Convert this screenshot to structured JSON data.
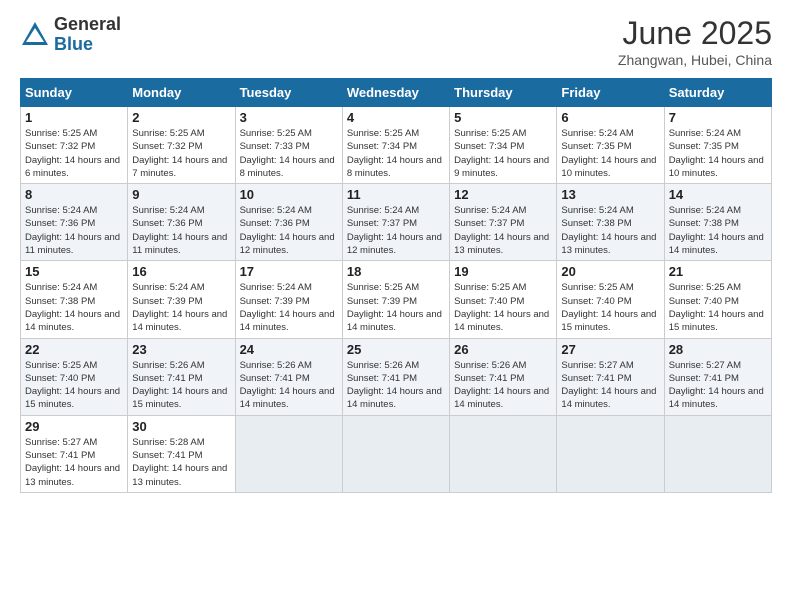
{
  "header": {
    "logo_general": "General",
    "logo_blue": "Blue",
    "month_title": "June 2025",
    "location": "Zhangwan, Hubei, China"
  },
  "days_of_week": [
    "Sunday",
    "Monday",
    "Tuesday",
    "Wednesday",
    "Thursday",
    "Friday",
    "Saturday"
  ],
  "weeks": [
    [
      {
        "day": 1,
        "sunrise": "5:25 AM",
        "sunset": "7:32 PM",
        "daylight": "14 hours and 6 minutes."
      },
      {
        "day": 2,
        "sunrise": "5:25 AM",
        "sunset": "7:32 PM",
        "daylight": "14 hours and 7 minutes."
      },
      {
        "day": 3,
        "sunrise": "5:25 AM",
        "sunset": "7:33 PM",
        "daylight": "14 hours and 8 minutes."
      },
      {
        "day": 4,
        "sunrise": "5:25 AM",
        "sunset": "7:34 PM",
        "daylight": "14 hours and 8 minutes."
      },
      {
        "day": 5,
        "sunrise": "5:25 AM",
        "sunset": "7:34 PM",
        "daylight": "14 hours and 9 minutes."
      },
      {
        "day": 6,
        "sunrise": "5:24 AM",
        "sunset": "7:35 PM",
        "daylight": "14 hours and 10 minutes."
      },
      {
        "day": 7,
        "sunrise": "5:24 AM",
        "sunset": "7:35 PM",
        "daylight": "14 hours and 10 minutes."
      }
    ],
    [
      {
        "day": 8,
        "sunrise": "5:24 AM",
        "sunset": "7:36 PM",
        "daylight": "14 hours and 11 minutes."
      },
      {
        "day": 9,
        "sunrise": "5:24 AM",
        "sunset": "7:36 PM",
        "daylight": "14 hours and 11 minutes."
      },
      {
        "day": 10,
        "sunrise": "5:24 AM",
        "sunset": "7:36 PM",
        "daylight": "14 hours and 12 minutes."
      },
      {
        "day": 11,
        "sunrise": "5:24 AM",
        "sunset": "7:37 PM",
        "daylight": "14 hours and 12 minutes."
      },
      {
        "day": 12,
        "sunrise": "5:24 AM",
        "sunset": "7:37 PM",
        "daylight": "14 hours and 13 minutes."
      },
      {
        "day": 13,
        "sunrise": "5:24 AM",
        "sunset": "7:38 PM",
        "daylight": "14 hours and 13 minutes."
      },
      {
        "day": 14,
        "sunrise": "5:24 AM",
        "sunset": "7:38 PM",
        "daylight": "14 hours and 14 minutes."
      }
    ],
    [
      {
        "day": 15,
        "sunrise": "5:24 AM",
        "sunset": "7:38 PM",
        "daylight": "14 hours and 14 minutes."
      },
      {
        "day": 16,
        "sunrise": "5:24 AM",
        "sunset": "7:39 PM",
        "daylight": "14 hours and 14 minutes."
      },
      {
        "day": 17,
        "sunrise": "5:24 AM",
        "sunset": "7:39 PM",
        "daylight": "14 hours and 14 minutes."
      },
      {
        "day": 18,
        "sunrise": "5:25 AM",
        "sunset": "7:39 PM",
        "daylight": "14 hours and 14 minutes."
      },
      {
        "day": 19,
        "sunrise": "5:25 AM",
        "sunset": "7:40 PM",
        "daylight": "14 hours and 14 minutes."
      },
      {
        "day": 20,
        "sunrise": "5:25 AM",
        "sunset": "7:40 PM",
        "daylight": "14 hours and 15 minutes."
      },
      {
        "day": 21,
        "sunrise": "5:25 AM",
        "sunset": "7:40 PM",
        "daylight": "14 hours and 15 minutes."
      }
    ],
    [
      {
        "day": 22,
        "sunrise": "5:25 AM",
        "sunset": "7:40 PM",
        "daylight": "14 hours and 15 minutes."
      },
      {
        "day": 23,
        "sunrise": "5:26 AM",
        "sunset": "7:41 PM",
        "daylight": "14 hours and 15 minutes."
      },
      {
        "day": 24,
        "sunrise": "5:26 AM",
        "sunset": "7:41 PM",
        "daylight": "14 hours and 14 minutes."
      },
      {
        "day": 25,
        "sunrise": "5:26 AM",
        "sunset": "7:41 PM",
        "daylight": "14 hours and 14 minutes."
      },
      {
        "day": 26,
        "sunrise": "5:26 AM",
        "sunset": "7:41 PM",
        "daylight": "14 hours and 14 minutes."
      },
      {
        "day": 27,
        "sunrise": "5:27 AM",
        "sunset": "7:41 PM",
        "daylight": "14 hours and 14 minutes."
      },
      {
        "day": 28,
        "sunrise": "5:27 AM",
        "sunset": "7:41 PM",
        "daylight": "14 hours and 14 minutes."
      }
    ],
    [
      {
        "day": 29,
        "sunrise": "5:27 AM",
        "sunset": "7:41 PM",
        "daylight": "14 hours and 13 minutes."
      },
      {
        "day": 30,
        "sunrise": "5:28 AM",
        "sunset": "7:41 PM",
        "daylight": "14 hours and 13 minutes."
      },
      null,
      null,
      null,
      null,
      null
    ]
  ]
}
